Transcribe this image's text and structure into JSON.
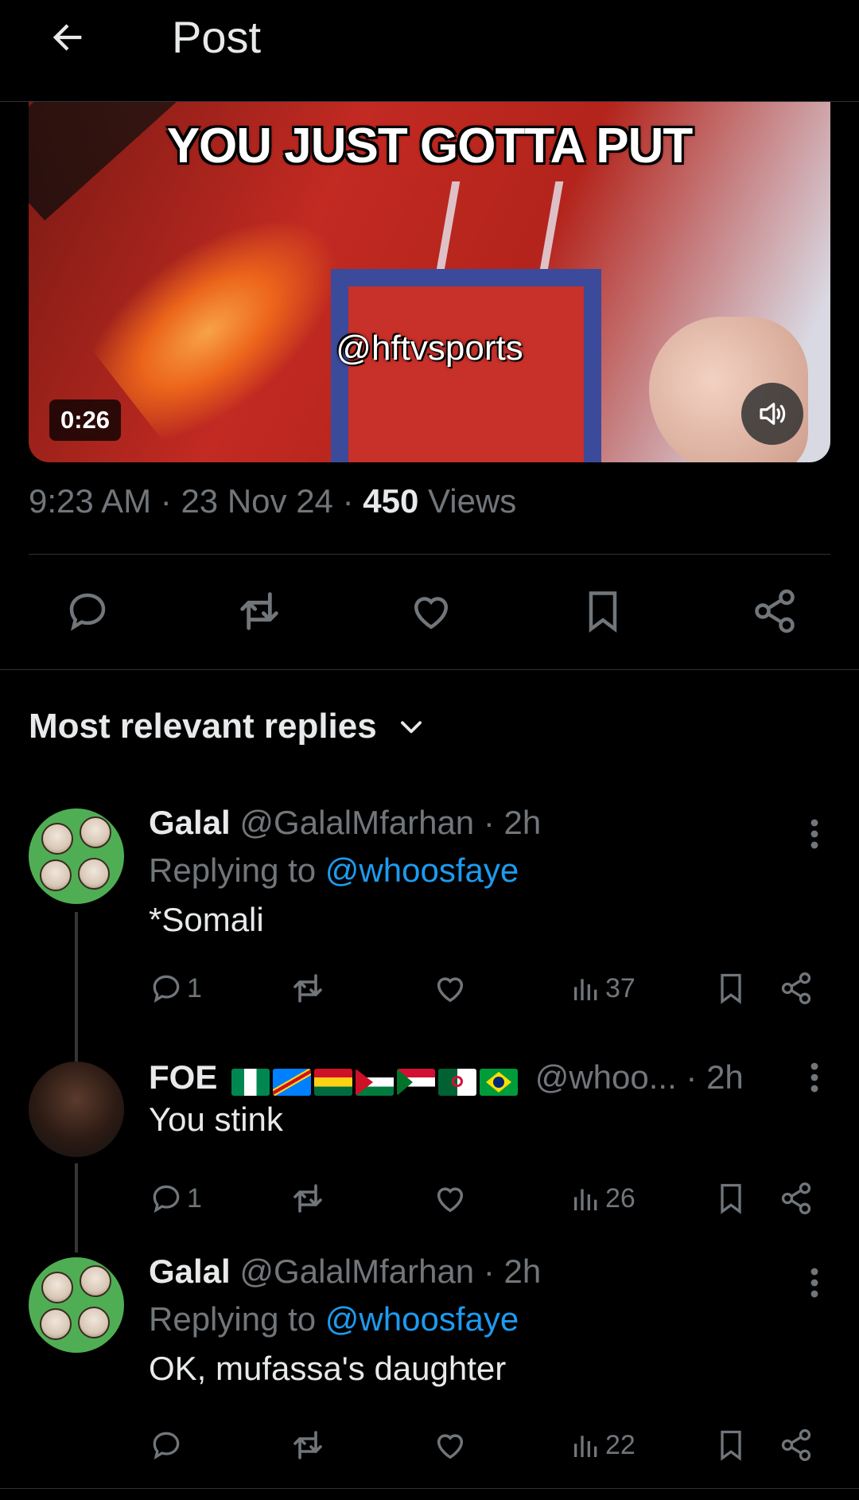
{
  "header": {
    "title": "Post"
  },
  "video": {
    "caption": "YOU JUST GOTTA PUT",
    "watermark": "@hftvsports",
    "duration": "0:26"
  },
  "post_meta": {
    "time": "9:23 AM",
    "sep1": "·",
    "date": "23 Nov 24",
    "sep2": "·",
    "views_count": "450",
    "views_label": "Views"
  },
  "sort": {
    "label": "Most relevant replies"
  },
  "replies": [
    {
      "name": "Galal",
      "handle": "@GalalMfarhan",
      "time": "· 2h",
      "replying_prefix": "Replying to",
      "replying_to": "@whoosfaye",
      "text": "*Somali",
      "reply_count": "1",
      "retweet_count": "",
      "like_count": "",
      "views": "37"
    },
    {
      "name": "FOE",
      "flags": [
        "Nigeria",
        "DR Congo",
        "Ghana",
        "Palestine",
        "Sudan",
        "Algeria",
        "Brazil"
      ],
      "handle": "@whoo...",
      "time": "· 2h",
      "text": "You stink",
      "reply_count": "1",
      "views": "26"
    },
    {
      "name": "Galal",
      "handle": "@GalalMfarhan",
      "time": "· 2h",
      "replying_prefix": "Replying to",
      "replying_to": "@whoosfaye",
      "text": "OK, mufassa's daughter",
      "reply_count": "",
      "views": "22"
    }
  ],
  "colors": {
    "background": "#000000",
    "text": "#e7e9ea",
    "muted": "#71767b",
    "accent": "#1d9bf0",
    "divider": "#2f3336"
  },
  "icons": [
    "back-arrow-icon",
    "speaker-icon",
    "reply-icon",
    "retweet-icon",
    "like-icon",
    "bookmark-icon",
    "share-icon",
    "chevron-down-icon",
    "more-vertical-icon",
    "views-icon"
  ]
}
